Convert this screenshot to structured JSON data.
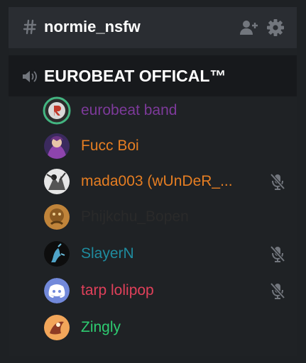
{
  "text_channel": {
    "icon": "hash-icon",
    "name": "normie_nsfw",
    "actions": [
      "add-member-icon",
      "gear-icon"
    ]
  },
  "voice_channel": {
    "icon": "speaker-icon",
    "name": "EUROBEAT OFFICAL™"
  },
  "users": [
    {
      "name": "eurobeat band",
      "color": "#7d3a9a",
      "muted": false,
      "speaking": true
    },
    {
      "name": "Fucc Boi",
      "color": "#e67e22",
      "muted": false,
      "speaking": false
    },
    {
      "name": "mada003 (wUnDeR_...",
      "color": "#e67e22",
      "muted": true,
      "speaking": false
    },
    {
      "name": "Phijkchu_Bopen",
      "color": "#2a2a2a",
      "muted": false,
      "speaking": false
    },
    {
      "name": "SlayerN",
      "color": "#1f8b9e",
      "muted": true,
      "speaking": false
    },
    {
      "name": "tarp lolipop",
      "color": "#e0405a",
      "muted": true,
      "speaking": false
    },
    {
      "name": "Zingly",
      "color": "#2ecc71",
      "muted": false,
      "speaking": false
    }
  ],
  "colors": {
    "background": "#1e2124",
    "speaking_ring": "#43b581",
    "icon_gray": "#72767d"
  }
}
